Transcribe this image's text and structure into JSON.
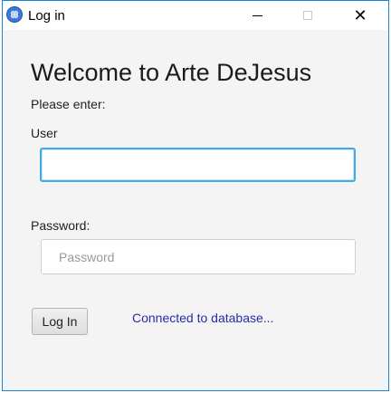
{
  "window": {
    "title": "Log in",
    "close_glyph": "✕"
  },
  "form": {
    "heading": "Welcome to Arte DeJesus",
    "prompt": "Please enter:",
    "user_label": "User",
    "user_value": "",
    "password_label": "Password:",
    "password_placeholder": "Password",
    "login_button": "Log In",
    "status_text": "Connected to database..."
  },
  "colors": {
    "window_border": "#1883d7",
    "focus_border": "#45a8e6",
    "status_text": "#2a2aa8"
  },
  "icons": {
    "app": "app-globe-icon",
    "minimize": "minimize-icon",
    "maximize": "maximize-icon",
    "close": "close-icon"
  }
}
